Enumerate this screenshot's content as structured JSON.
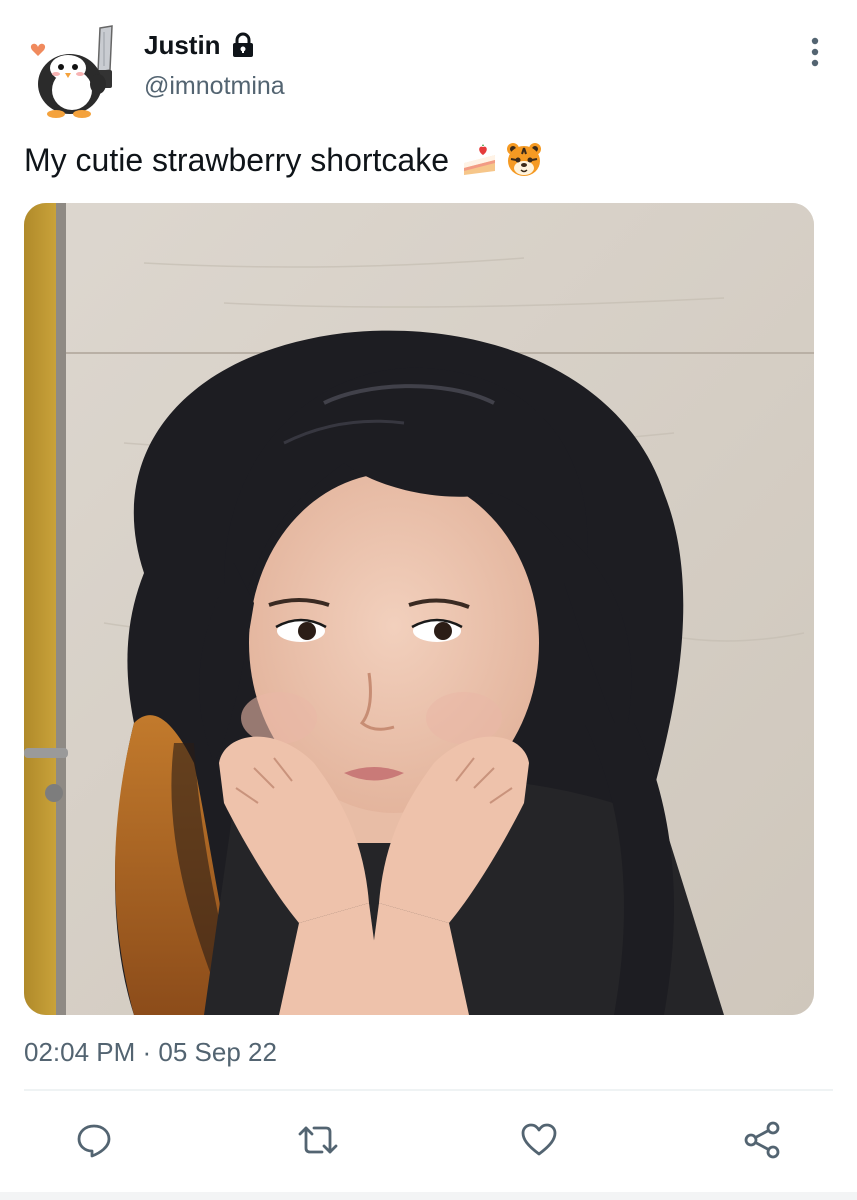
{
  "user": {
    "display_name": "Justin",
    "handle": "@imnotmina",
    "protected": true,
    "avatar_icon": "penguin-with-knife-icon"
  },
  "tweet": {
    "text": "My cutie strawberry shortcake",
    "emojis": [
      "shortcake-emoji",
      "tiger-face-emoji"
    ]
  },
  "media": {
    "type": "photo",
    "icon": "photo-image"
  },
  "meta": {
    "timestamp": "02:04 PM · 05 Sep 22"
  },
  "actions": [
    {
      "icon": "reply-icon"
    },
    {
      "icon": "retweet-icon"
    },
    {
      "icon": "like-icon"
    },
    {
      "icon": "share-icon"
    }
  ],
  "colors": {
    "text": "#0f1419",
    "secondary": "#536471",
    "divider": "#eff3f4"
  }
}
